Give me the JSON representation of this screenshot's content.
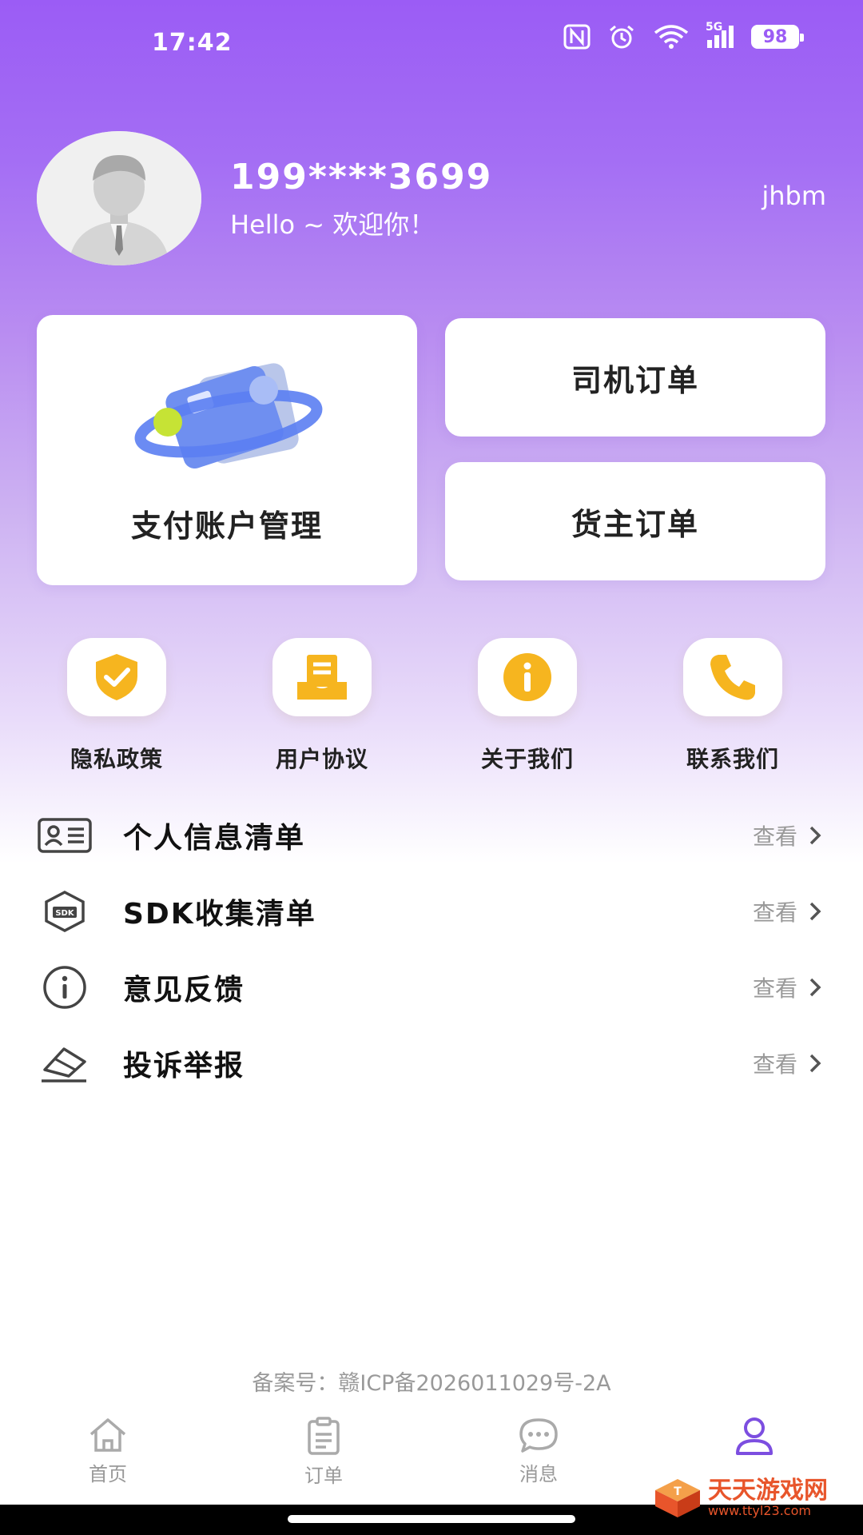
{
  "status_bar": {
    "time": "17:42",
    "network": "5G",
    "battery": "98"
  },
  "profile": {
    "phone": "199****3699",
    "greeting": "Hello ~ 欢迎你！",
    "tag": "jhbm"
  },
  "cards": {
    "payment_account": "支付账户管理",
    "driver_orders": "司机订单",
    "owner_orders": "货主订单"
  },
  "quick_links": [
    {
      "label": "隐私政策",
      "icon": "shield-check-icon"
    },
    {
      "label": "用户协议",
      "icon": "document-tray-icon"
    },
    {
      "label": "关于我们",
      "icon": "info-icon"
    },
    {
      "label": "联系我们",
      "icon": "phone-icon"
    }
  ],
  "list": [
    {
      "title": "个人信息清单",
      "action": "查看",
      "icon": "id-card-icon"
    },
    {
      "title": "SDK收集清单",
      "action": "查看",
      "icon": "sdk-cube-icon"
    },
    {
      "title": "意见反馈",
      "action": "查看",
      "icon": "info-circle-icon"
    },
    {
      "title": "投诉举报",
      "action": "查看",
      "icon": "eraser-icon"
    }
  ],
  "icp": "备案号：赣ICP备2026011029号-2A",
  "tabs": [
    {
      "label": "首页",
      "icon": "home-icon"
    },
    {
      "label": "订单",
      "icon": "clipboard-icon"
    },
    {
      "label": "消息",
      "icon": "chat-icon"
    },
    {
      "label": "",
      "icon": "user-icon",
      "active": true
    }
  ],
  "watermark": {
    "name": "天天游戏网",
    "url": "www.ttyl23.com"
  },
  "colors": {
    "accent": "#7c4ee0",
    "gradient_top": "#9b5cf5",
    "quick_icon": "#f6b51f",
    "watermark": "#e8552b"
  }
}
